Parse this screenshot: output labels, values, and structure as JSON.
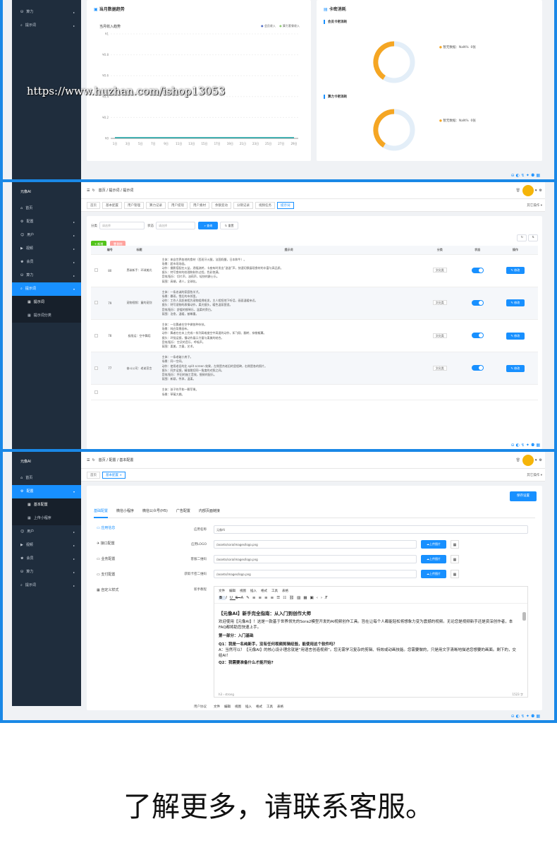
{
  "watermark": "https://www.huzhan.com/ishop13053",
  "footer": "了解更多，请联系客服。",
  "p1": {
    "sidebar": [
      {
        "label": "算力",
        "icon": "db-icon"
      },
      {
        "label": "提示词",
        "icon": "search-icon"
      }
    ],
    "trend_card": {
      "title": "当月数据趋势",
      "subtitle": "当月收入趋势",
      "legend": [
        "会员收入",
        "算力套餐收入"
      ],
      "yticks": [
        "¥1",
        "¥0.8",
        "¥0.6",
        "¥0.4",
        "¥0.2",
        "¥0"
      ],
      "xticks": [
        "1日",
        "3日",
        "5日",
        "7日",
        "9日",
        "11日",
        "13日",
        "15日",
        "17日",
        "19日",
        "21日",
        "23日",
        "25日",
        "27日",
        "29日"
      ]
    },
    "card_card": {
      "title": "卡密消耗",
      "section1": "会员卡密消耗",
      "section2": "算力卡密消耗",
      "legend1": "暂无数据：NaN%",
      "legend1_count": "0张",
      "legend2": "暂无数据：NaN%",
      "legend2_count": "0张"
    },
    "chart_data": {
      "type": "line",
      "title": "当月收入趋势",
      "categories": [
        "1日",
        "3日",
        "5日",
        "7日",
        "9日",
        "11日",
        "13日",
        "15日",
        "17日",
        "19日",
        "21日",
        "23日",
        "25日",
        "27日",
        "29日"
      ],
      "series": [
        {
          "name": "会员收入",
          "values": [
            0,
            0,
            0,
            0,
            0,
            0,
            0,
            0,
            0,
            0,
            0,
            0,
            0,
            0,
            0
          ]
        },
        {
          "name": "算力套餐收入",
          "values": [
            0,
            0,
            0,
            0,
            0,
            0,
            0,
            0,
            0,
            0,
            0,
            0,
            0,
            0,
            0
          ]
        }
      ],
      "ylim": [
        0,
        1
      ],
      "colors": [
        "#5470c6",
        "#91cc75"
      ]
    }
  },
  "p2": {
    "logo": "元像AI",
    "breadcrumb": "首页 / 提示词 / 提示词",
    "sidebar": [
      {
        "label": "首页",
        "icon": "home-icon"
      },
      {
        "label": "配置",
        "icon": "gear-icon"
      },
      {
        "label": "用户",
        "icon": "user-icon"
      },
      {
        "label": "视频",
        "icon": "video-icon"
      },
      {
        "label": "会员",
        "icon": "vip-icon"
      },
      {
        "label": "算力",
        "icon": "db-icon"
      },
      {
        "label": "提示词",
        "icon": "search-icon"
      },
      {
        "label": "提示词",
        "icon": "grid-icon"
      },
      {
        "label": "提示词分类",
        "icon": "grid-icon"
      }
    ],
    "tags": [
      "首页",
      "基本配置",
      "用户管理",
      "算力记录",
      "用户提现",
      "用户素材",
      "余额变动",
      "分销记录",
      "视频任务",
      "提示词"
    ],
    "more_ops": "其它操作",
    "filter": {
      "cat_label": "分类",
      "cat_placeholder": "请选择",
      "status_label": "状态",
      "status_placeholder": "请选择",
      "search": "查询",
      "reset": "重置"
    },
    "add": "+ 新增",
    "del": "删除",
    "columns": [
      "",
      "编号",
      "标题",
      "提示词",
      "分类",
      "状态",
      "操作"
    ],
    "rows": [
      {
        "id": "80",
        "title": "黑碳新手：环球美光",
        "lines": [
          "主体：来自世界各地的食材（西班牙火腿，法国奶酪，日本和牛）。",
          "场景：超市现场画。",
          "动作：摄影搭配在火盆，逐幅流转，卡座有时发出“滋滋”声，快速切换展现食材的丰富与高品质。",
          "镜头：特写食材的纹理和制作过程，色彩饱满。",
          "音效/配乐：切片声，油煎声，轻快的爵士乐。",
          "氛围：高端，诱人，全球化。"
        ],
        "cat": "文化类",
        "op": "修改"
      },
      {
        "id": "79",
        "title": "宠物视频：童的宠别",
        "lines": [
          "主体：一条忠诚的家庭牧羊犬。",
          "场景：暴雨，雪后的市郊里。",
          "动作：工作人员赶来相为宠物组拥毛发，主人相恒地下听话，画面温暖亲近。",
          "镜头：特写宠物的表情动作，柔光镜头，暖色温氛营造。",
          "音效/配乐：舒缓的钢琴乐，温柔的旁白。",
          "氛围：治愈，温暖，被尊重。"
        ],
        "cat": "文化类",
        "op": "修改"
      },
      {
        "id": "78",
        "title": "极限运：空中舞蹈",
        "lines": [
          "主体：一位舞者在空中做各种杂技。",
          "场景：纯白背景画布。",
          "动作：舞者在在未上完成一系列高难度空中高速的动作，如飞翔、翻转、穿梭躯翼。",
          "镜头：环绕运镜，慢动作展示力量与柔美的结合。",
          "音效/配乐：空灵的音乐，呼吸声。",
          "氛围：柔美，力量，艺术。"
        ],
        "cat": "文化类",
        "op": "修改"
      },
      {
        "id": "77",
        "title": "奋斗公司：老弟宣言",
        "lines": [
          "主体：一条老破小房子。",
          "场景：同一空间。",
          "动作：使用老旧的比 split screen 效果，左侧是杰老旧的里程碑，右侧是各的照片。",
          "镜头：同步运镜，精准跳切同一角度的对照之间。",
          "音效/配乐：怀旧的施工音效，细致的配乐。",
          "氛围：新颖，传承，温柔。"
        ],
        "cat": "文化类",
        "op": "修改"
      },
      {
        "id": "",
        "title": "",
        "lines": [
          "主体：孩子的手和一颗苹果。",
          "场景：草莓大棚。"
        ],
        "cat": "",
        "op": ""
      }
    ]
  },
  "p3": {
    "logo": "元像AI",
    "breadcrumb": "首页 / 配置 / 基本配置",
    "sidebar": [
      {
        "label": "首页",
        "icon": "home-icon"
      },
      {
        "label": "配置",
        "icon": "gear-icon"
      },
      {
        "label": "基本配置",
        "icon": "grid-icon"
      },
      {
        "label": "上传小程序",
        "icon": "grid-icon"
      },
      {
        "label": "用户",
        "icon": "user-icon"
      },
      {
        "label": "视频",
        "icon": "video-icon"
      },
      {
        "label": "会员",
        "icon": "vip-icon"
      },
      {
        "label": "算力",
        "icon": "db-icon"
      },
      {
        "label": "提示词",
        "icon": "search-icon"
      }
    ],
    "tags": [
      "首页",
      "基本配置"
    ],
    "more_ops": "其它操作",
    "save": "保存设置",
    "tabs": [
      "基础配置",
      "微信小程序",
      "微信公众号(H5)",
      "广告配置",
      "内部页面链接"
    ],
    "side_menu": [
      "应用信息",
      "接口配置",
      "业务配置",
      "支付配置",
      "自定义样式"
    ],
    "fields": [
      {
        "label": "应用名称",
        "value": "元像AI",
        "btn": ""
      },
      {
        "label": "应用LOGO",
        "value": "/assets/sora/images/logo.png",
        "btn": "上传图片"
      },
      {
        "label": "客服二维码",
        "value": "/assets/sora/images/logo.png",
        "btn": "上传图片"
      },
      {
        "label": "获取卡密二维码",
        "value": "/assets/images/logo.png",
        "btn": "上传图片"
      }
    ],
    "editor_label": "新手教程",
    "editor_menu": [
      "文件",
      "编辑",
      "视图",
      "插入",
      "格式",
      "工具",
      "表格"
    ],
    "editor_title": "【元像AI】新手完全指南：从入门到创作大师",
    "editor_p1": "欢迎使用【元像AI】！这是一款基于世界领先的Sora2模型开发的AI视频创作工具。旨在让每个人都能轻松将想象力变为震撼的视频。无论您是视频新手还是资深创作者，本FAQ都将助您快速上手。",
    "editor_h2": "第一部分：入门基础",
    "editor_q1": "Q1：我是一名纯新手，没有任何视频剪辑经验，能使用这个软件吗？",
    "editor_a1": "A：当然可以！【元像AI】的核心设计理念就是“用语言创造视频”。您无需学习复杂的剪辑、特效或动画技能。您需要做的，只是用文字清晰地描述您想要的画面。剩下的，交给AI！",
    "editor_q2": "Q2：我需要准备什么才能开始?",
    "editor_status": "h3 › strong",
    "editor_count": "1523 字",
    "user_sign_label": "用户协议"
  }
}
